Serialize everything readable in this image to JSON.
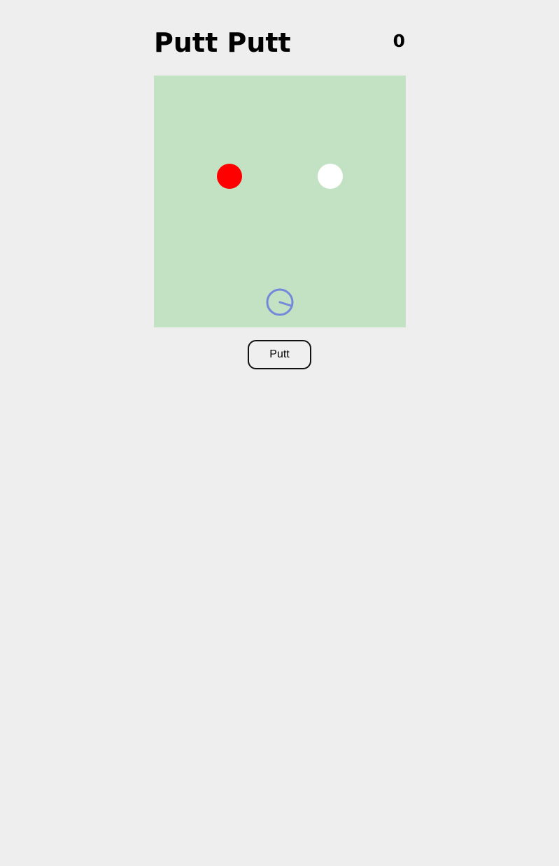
{
  "game": {
    "title": "Putt Putt",
    "score": "0"
  },
  "controls": {
    "putt_label": "Putt"
  },
  "colors": {
    "page_background": "#eeeeee",
    "course": "#c3e1c3",
    "hole": "#ff0000",
    "ball": "#ffffff",
    "aim_indicator": "#6b7fdc"
  },
  "icons": {
    "aim": "aim-dial-icon"
  }
}
